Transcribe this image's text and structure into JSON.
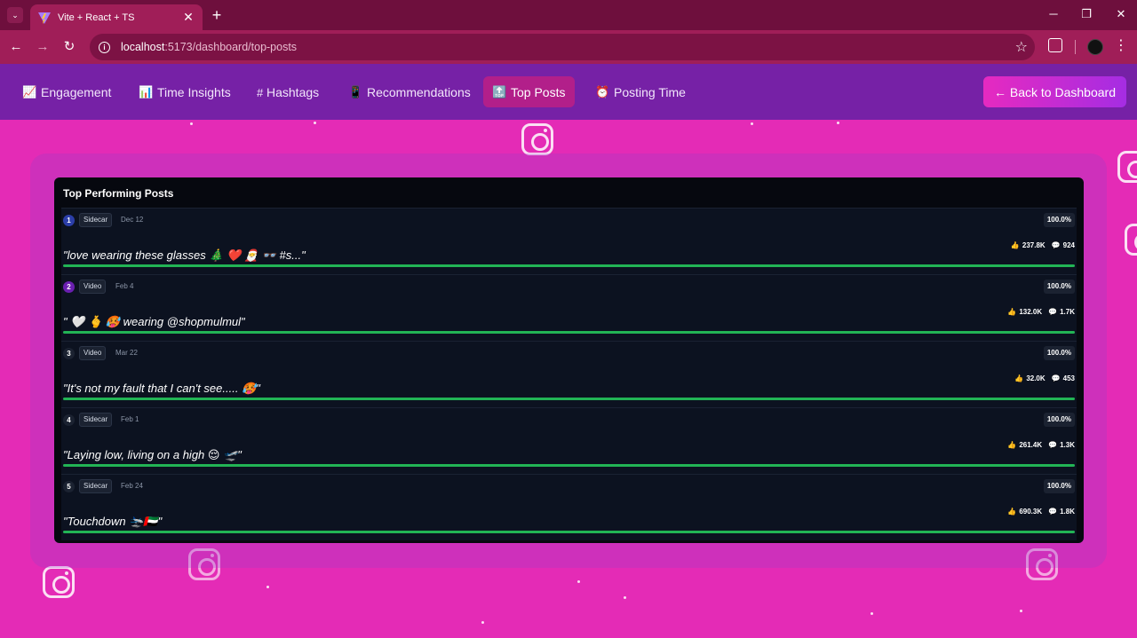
{
  "browser": {
    "tab_title": "Vite + React + TS",
    "url_host": "localhost",
    "url_rest": ":5173/dashboard/top-posts"
  },
  "nav": {
    "items": [
      {
        "icon": "📈",
        "label": "Engagement"
      },
      {
        "icon": "📊",
        "label": "Time Insights"
      },
      {
        "icon": "#",
        "label": "Hashtags"
      },
      {
        "icon": "📱",
        "label": "Recommendations"
      },
      {
        "icon": "🔝",
        "label": "Top Posts"
      },
      {
        "icon": "⏰",
        "label": "Posting Time"
      }
    ],
    "active_index": 4,
    "back_button": "← Back to  Dashboard"
  },
  "panel": {
    "title": "Top Performing Posts"
  },
  "posts": [
    {
      "rank": "1",
      "type": "Sidecar",
      "date": "Dec 12",
      "percent": "100.0%",
      "caption": "\"love wearing these glasses 🎄 ❤️ 🎅 👓 #s...\"",
      "likes": "237.8K",
      "comments": "924",
      "progress": 1.0,
      "rank_color": "#2b3ea8"
    },
    {
      "rank": "2",
      "type": "Video",
      "date": "Feb 4",
      "percent": "100.0%",
      "caption": "\" 🤍 🫰 🥵 wearing @shopmulmul\"",
      "likes": "132.0K",
      "comments": "1.7K",
      "progress": 1.0,
      "rank_color": "#6a1fb0"
    },
    {
      "rank": "3",
      "type": "Video",
      "date": "Mar 22",
      "percent": "100.0%",
      "caption": "\"It's not my fault that I can't see..... 🥵\"",
      "likes": "32.0K",
      "comments": "453",
      "progress": 1.0,
      "rank_color": "#1b2231"
    },
    {
      "rank": "4",
      "type": "Sidecar",
      "date": "Feb 1",
      "percent": "100.0%",
      "caption": "\"Laying low, living on a high 😌 🛫\"",
      "likes": "261.4K",
      "comments": "1.3K",
      "progress": 1.0,
      "rank_color": "#1b2231"
    },
    {
      "rank": "5",
      "type": "Sidecar",
      "date": "Feb 24",
      "percent": "100.0%",
      "caption": "\"Touchdown 🛬🇦🇪\"",
      "likes": "690.3K",
      "comments": "1.8K",
      "progress": 1.0,
      "rank_color": "#1b2231"
    }
  ],
  "colors": {
    "accent": "#e62ac0",
    "progress_fill": "#22b455",
    "nav_bg": "#7621a6",
    "page_bg": "#e42bb6"
  }
}
